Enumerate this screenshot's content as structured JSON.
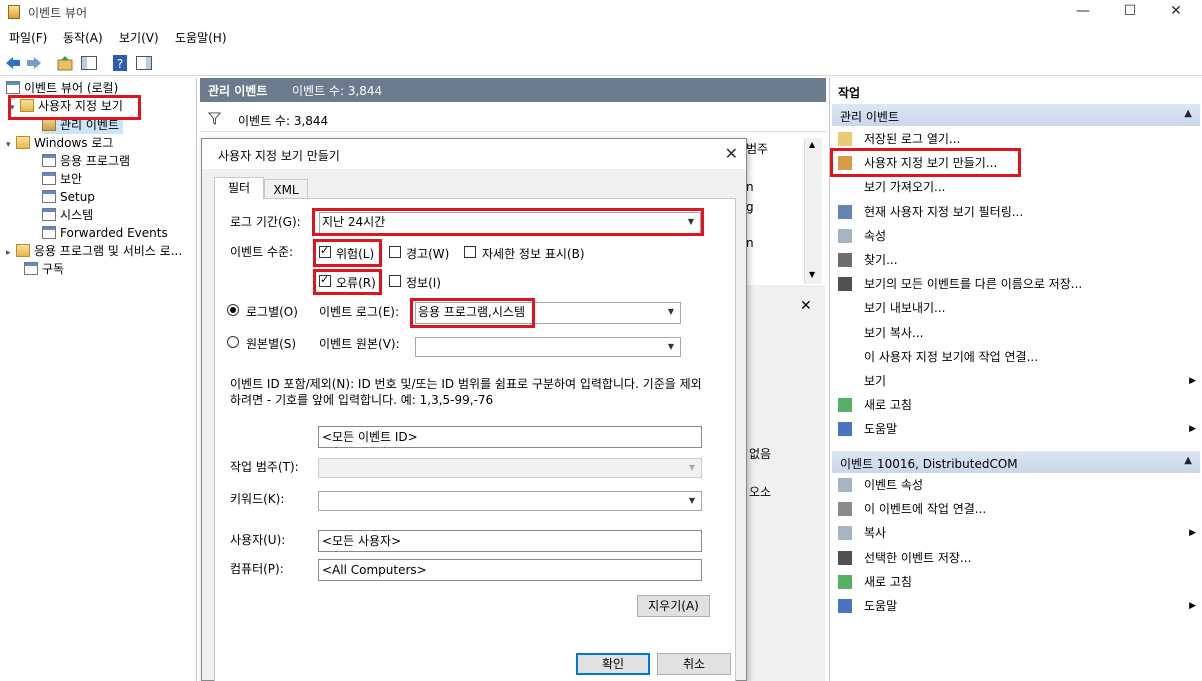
{
  "window": {
    "title": "이벤트 뷰어",
    "minimize": "—",
    "maximize": "☐",
    "close": "✕"
  },
  "menu": [
    "파일(F)",
    "동작(A)",
    "보기(V)",
    "도움말(H)"
  ],
  "tree": {
    "root": "이벤트 뷰어 (로컬)",
    "custom_views": "사용자 지정 보기",
    "admin_events": "관리 이벤트",
    "windows_logs": "Windows 로그",
    "application": "응용 프로그램",
    "security": "보안",
    "setup": "Setup",
    "system": "시스템",
    "forwarded": "Forwarded Events",
    "apps_services": "응용 프로그램 및 서비스 로...",
    "subscriptions": "구독"
  },
  "center": {
    "header_title": "관리 이벤트",
    "header_count": "이벤트 수: 3,844",
    "filter_count": "이벤트 수: 3,844",
    "bg_fragments": [
      "범주",
      "n",
      "g",
      "n",
      "없음",
      "오소"
    ]
  },
  "dialog": {
    "title": "사용자 지정 보기 만들기",
    "tabs": [
      "필터",
      "XML"
    ],
    "log_period_label": "로그 기간(G):",
    "log_period_value": "지난 24시간",
    "event_level_label": "이벤트 수준:",
    "levels": {
      "critical": "위험(L)",
      "warning": "경고(W)",
      "verbose": "자세한 정보 표시(B)",
      "error": "오류(R)",
      "info": "정보(I)"
    },
    "by_log_label": "로그별(O)",
    "event_logs_label": "이벤트 로그(E):",
    "event_logs_value": "응용 프로그램,시스템",
    "by_source_label": "원본별(S)",
    "event_source_label": "이벤트 원본(V):",
    "event_source_value": "",
    "id_help": "이벤트 ID 포함/제외(N): ID 번호 및/또는 ID 범위를 쉼표로 구분하여 입력합니다. 기준을 제외하려면 - 기호를 앞에 입력합니다. 예: 1,3,5-99,-76",
    "id_value": "<모든 이벤트 ID>",
    "task_category_label": "작업 범주(T):",
    "keywords_label": "키워드(K):",
    "user_label": "사용자(U):",
    "user_value": "<모든 사용자>",
    "computer_label": "컴퓨터(P):",
    "computer_value": "<All Computers>",
    "clear_button": "지우기(A)",
    "ok_button": "확인",
    "cancel_button": "취소"
  },
  "actions": {
    "title": "작업",
    "section1": "관리 이벤트",
    "items1": [
      "저장된 로그 열기...",
      "사용자 지정 보기 만들기...",
      "보기 가져오기...",
      "현재 사용자 지정 보기 필터링...",
      "속성",
      "찾기...",
      "보기의 모든 이벤트를 다른 이름으로 저장...",
      "보기 내보내기...",
      "보기 복사...",
      "이 사용자 지정 보기에 작업 연결...",
      "보기",
      "새로 고침",
      "도움말"
    ],
    "section2": "이벤트 10016, DistributedCOM",
    "items2": [
      "이벤트 속성",
      "이 이벤트에 작업 연결...",
      "복사",
      "선택한 이벤트 저장...",
      "새로 고침",
      "도움말"
    ]
  },
  "colors": {
    "highlight": "#e0141e",
    "header_bg": "#6c7a8e",
    "section_bg": "#c9d7ea",
    "accent": "#0078d7"
  }
}
